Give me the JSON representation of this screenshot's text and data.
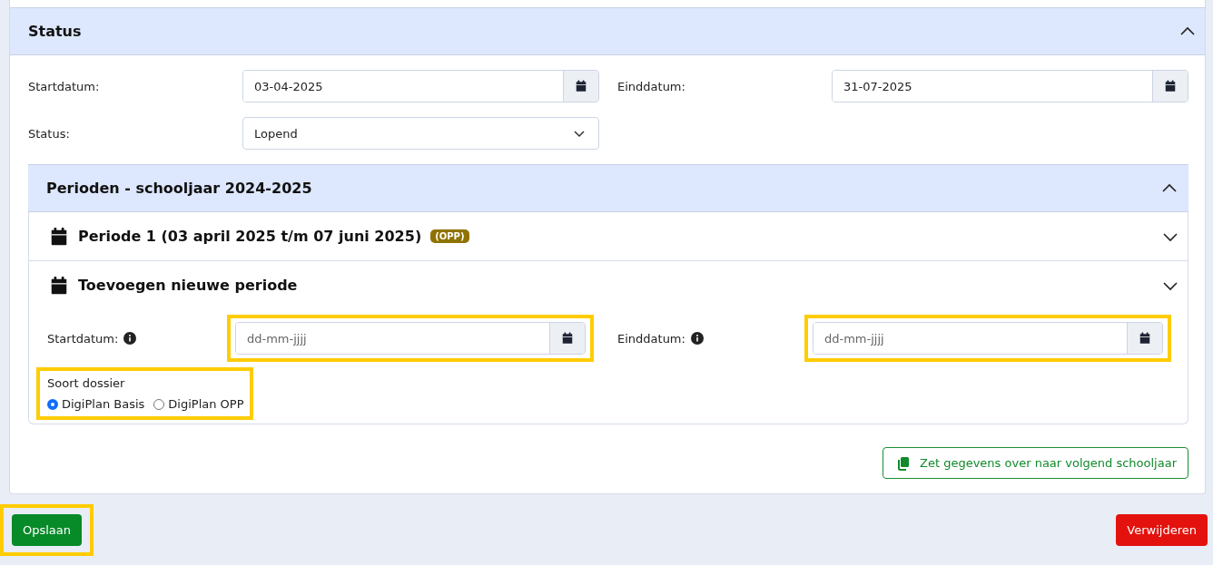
{
  "status_panel": {
    "title": "Status",
    "expanded": true,
    "fields": [
      {
        "kind": "date",
        "label": "Startdatum:",
        "value": "03-04-2025"
      },
      {
        "kind": "date",
        "label": "Einddatum:",
        "value": "31-07-2025"
      },
      {
        "kind": "select",
        "label": "Status:",
        "value": "Lopend"
      }
    ]
  },
  "periods_panel": {
    "title": "Perioden - schooljaar 2024-2025",
    "expanded": true,
    "items": [
      {
        "title": "Periode 1 (03 april 2025 t/m 07 juni 2025)",
        "badge": "(OPP)",
        "expanded": false
      },
      {
        "title": "Toevoegen nieuwe periode",
        "expanded": false,
        "fields": [
          {
            "label": "Startdatum:",
            "placeholder": "dd-mm-jjjj",
            "highlighted": true
          },
          {
            "label": "Einddatum:",
            "placeholder": "dd-mm-jjjj",
            "highlighted": true
          }
        ],
        "dossier": {
          "label": "Soort dossier",
          "highlighted": true,
          "options": [
            {
              "label": "DigiPlan Basis",
              "selected": true
            },
            {
              "label": "DigiPlan OPP",
              "selected": false
            }
          ]
        }
      }
    ]
  },
  "transfer_button": "Zet gegevens over naar volgend schooljaar",
  "save_button": {
    "label": "Opslaan",
    "highlighted": true
  },
  "delete_button": "Verwijderen"
}
